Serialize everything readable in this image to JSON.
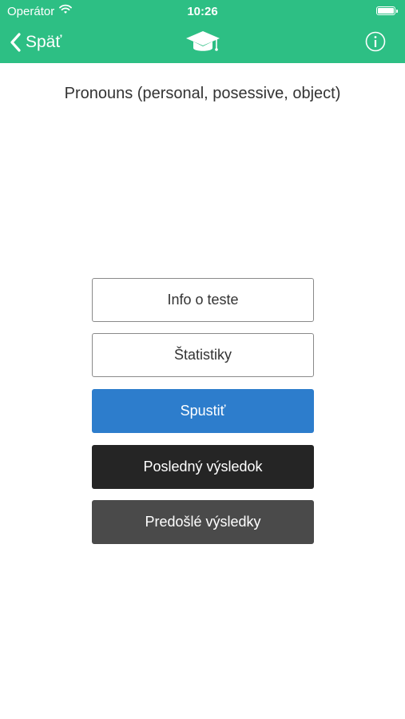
{
  "status_bar": {
    "carrier": "Operátor",
    "time": "10:26",
    "icons": [
      "wifi-icon",
      "battery-icon"
    ]
  },
  "nav": {
    "back_label": "Späť",
    "logo_icon": "graduation-cap-icon",
    "info_icon": "info-icon",
    "color": "#2dbf84"
  },
  "test": {
    "title": "Pronouns (personal, posessive, object)"
  },
  "buttons": {
    "info": "Info o teste",
    "stats": "Štatistiky",
    "start": "Spustiť",
    "last_result": "Posledný výsledok",
    "previous_results": "Predošlé výsledky"
  },
  "colors": {
    "accent": "#2dbf84",
    "start": "#2d7dcc",
    "last_result": "#252525",
    "previous_results": "#4a4a4a"
  }
}
